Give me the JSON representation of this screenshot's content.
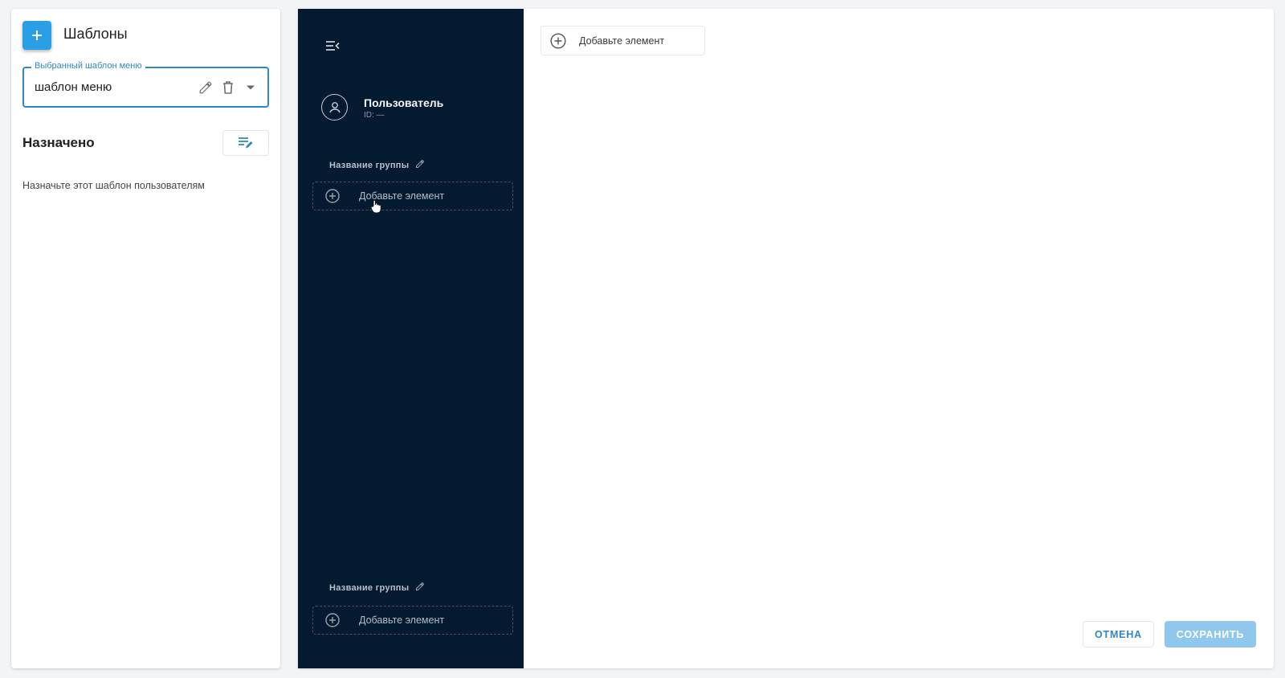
{
  "left_panel": {
    "title": "Шаблоны",
    "select": {
      "label": "Выбранный шаблон меню",
      "value": "шаблон меню"
    },
    "assigned_title": "Назначено",
    "assign_hint": "Назначьте этот шаблон пользователям"
  },
  "menu_preview": {
    "user": {
      "name": "Пользователь",
      "id": "ID: —"
    },
    "groups": [
      {
        "name": "Название группы",
        "add_item_label": "Добавьте элемент"
      },
      {
        "name": "Название группы",
        "add_item_label": "Добавьте элемент"
      }
    ]
  },
  "content": {
    "add_item_label": "Добавьте элемент"
  },
  "actions": {
    "cancel_label": "ОТМЕНА",
    "save_label": "СОХРАНИТЬ"
  },
  "colors": {
    "accent": "#2b9fe6",
    "sidebar_bg": "#031a30",
    "save_disabled": "#8fc8ec"
  }
}
